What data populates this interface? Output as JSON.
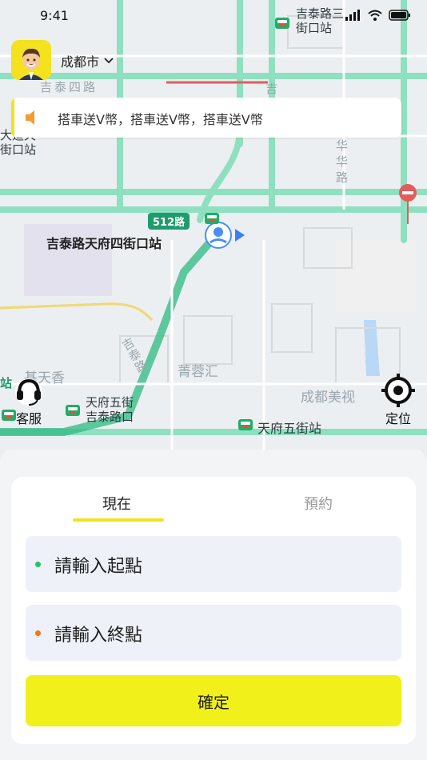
{
  "status_bar": {
    "time": "9:41"
  },
  "header": {
    "city": "成都市"
  },
  "notice": {
    "text": "搭車送V幣，搭車送V幣，搭車送V幣"
  },
  "map": {
    "labels": {
      "sanjie_station": "吉泰路三街口站",
      "jitai_4_road": "吉泰四路",
      "left_station": "大道天\n街口站",
      "huahua_road": "华\n华\n路",
      "road_512": "512路",
      "current_station": "吉泰路天府四街口站",
      "jitai_road": "吉泰路",
      "qingrong": "菁蓉汇",
      "xiang": "基天香",
      "chengdu_meishi": "成都美视",
      "tianfu5_jitai": "天府五街\n吉泰路口",
      "tianfu5_station": "天府五街站",
      "left_zhan": "站",
      "jitai_vertical": "吉"
    }
  },
  "controls": {
    "customer_service": "客服",
    "locate": "定位"
  },
  "booking": {
    "tabs": [
      "現在",
      "預約"
    ],
    "start_placeholder": "請輸入起點",
    "end_placeholder": "請輸入終點",
    "confirm": "確定"
  },
  "colors": {
    "brand_yellow": "#f2f01a",
    "road_green": "#8fe0c0",
    "route_green": "#2db982",
    "start_dot": "#22c55e",
    "end_dot": "#f97316",
    "traffic_red": "#e35b5b"
  },
  "icons": {
    "chevron": "chevron-down-icon",
    "speaker": "speaker-icon",
    "customer_service": "headset-icon",
    "locate": "crosshair-icon",
    "user_marker": "user-location-icon"
  }
}
